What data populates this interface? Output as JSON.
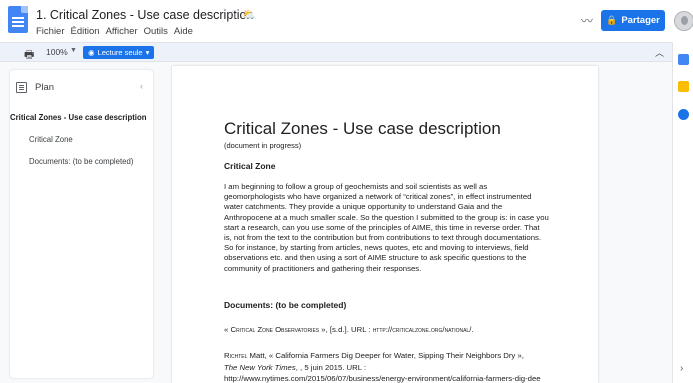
{
  "app": {
    "doc_title": "1. Critical Zones - Use case description",
    "menu": [
      "Fichier",
      "Édition",
      "Afficher",
      "Outils",
      "Aide"
    ],
    "share_label": "Partager"
  },
  "toolbar": {
    "zoom": "100%",
    "mode_label": "Lecture seule"
  },
  "outline": {
    "title": "Plan",
    "items": [
      "Critical Zones - Use case description",
      "Critical Zone",
      "Documents: (to be completed)"
    ]
  },
  "document": {
    "heading": "Critical Zones - Use case description",
    "subtitle": "(document in progress)",
    "section1_title": "Critical Zone",
    "paragraph": "I am beginning to follow a group of geochemists and soil scientists as well as geomorphologists who have organized a network of “critical zones”, in effect instrumented water catchments. They provide a unique opportunity to understand Gaia and the Anthropocene at a much smaller scale. So the question I submitted to the group is: in case you start a research, can you use some of the principles of AIME, this time in reverse order. That is, not from the text to the contribution but from contributions to text through documentations. So for instance, by starting from articles, news quotes, etc and moving to interviews, field observations etc. and then using a sort of AIME structure to ask specific questions to the community of practitioners and gathering their responses.",
    "section2_title": "Documents: (to be completed)",
    "ref1": {
      "open": "« ",
      "title": "Critical Zone Observatories",
      "middle": " », [s.d.]. URL : ",
      "url": "http://criticalzone.org/national/",
      "end": "."
    },
    "ref2": {
      "author": "Richtel",
      "rest": " Matt, « California Farmers Dig Deeper for Water, Sipping Their Neighbors Dry »,",
      "journal": "The New York Times",
      "date": ", , 5 juin 2015. URL :",
      "url": "http://www.nytimes.com/2015/06/07/business/energy-environment/california-farmers-dig-dee"
    }
  }
}
